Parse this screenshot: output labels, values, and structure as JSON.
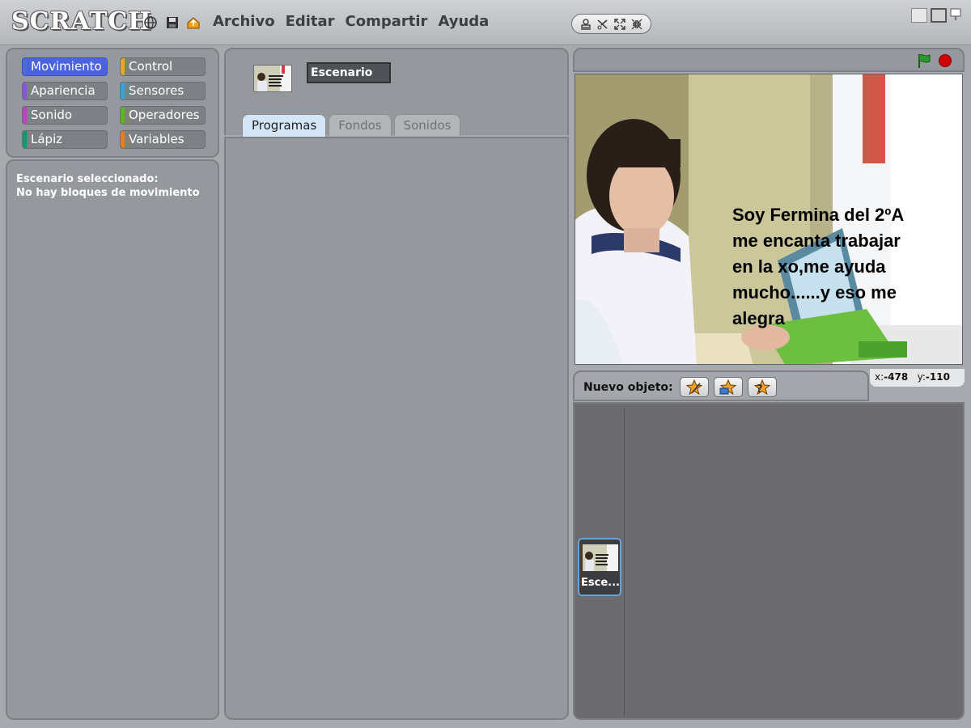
{
  "app": {
    "logo_text": "SCRATCH"
  },
  "menubar": {
    "items": [
      "Archivo",
      "Editar",
      "Compartir",
      "Ayuda"
    ]
  },
  "toolbar_icons": [
    "globe-icon",
    "save-icon",
    "share-icon"
  ],
  "edit_tools": [
    "stamp-icon",
    "cut-icon",
    "grow-icon",
    "shrink-icon"
  ],
  "categories": [
    {
      "label": "Movimiento",
      "color": "#4a6cd4",
      "selected": true
    },
    {
      "label": "Control",
      "color": "#e6a822"
    },
    {
      "label": "Apariencia",
      "color": "#8a55d7"
    },
    {
      "label": "Sensores",
      "color": "#2ca5e2"
    },
    {
      "label": "Sonido",
      "color": "#bb42c3"
    },
    {
      "label": "Operadores",
      "color": "#5cb712"
    },
    {
      "label": "Lápiz",
      "color": "#0e9a6c"
    },
    {
      "label": "Variables",
      "color": "#ee7d16"
    }
  ],
  "blocks_panel": {
    "line1": "Escenario seleccionado:",
    "line2": "No hay bloques de movimiento"
  },
  "sprite_header": {
    "name": "Escenario",
    "tabs": [
      "Programas",
      "Fondos",
      "Sonidos"
    ],
    "active_tab": "Programas"
  },
  "stage": {
    "text": "Soy  Fermina del 2ºA\nme  encanta trabajar\nen la xo,me ayuda\nmucho......y eso me\nalegra"
  },
  "new_sprite": {
    "label": "Nuevo objeto:"
  },
  "coords": {
    "x_label": "x:",
    "x": "-478",
    "y_label": "y:",
    "y": "-110"
  },
  "sprite_list": {
    "stage_label": "Esce..."
  },
  "colors": {
    "accent": "#4c63e0",
    "stop": "#d10000",
    "flag": "#2b9a2b"
  }
}
